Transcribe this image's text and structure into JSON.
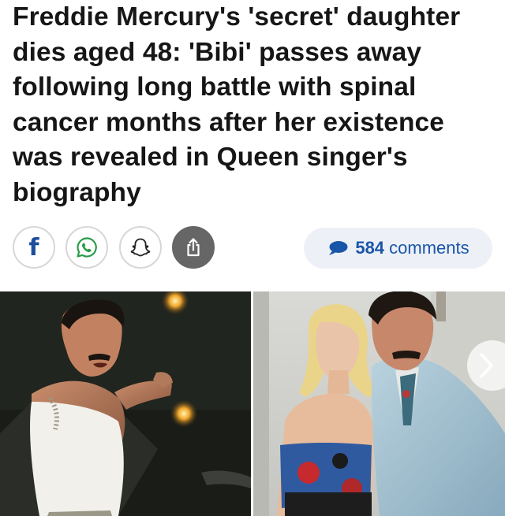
{
  "article": {
    "headline": "Freddie Mercury's 'secret' daughter dies aged 48: 'Bibi' passes away following long battle with spinal cancer months after her existence was revealed in Queen singer's biography"
  },
  "share": {
    "icons": [
      "facebook-icon",
      "whatsapp-icon",
      "snapchat-icon",
      "share-icon"
    ]
  },
  "comments": {
    "count": "584",
    "label": "comments",
    "color": "#1a56a8"
  },
  "gallery": {
    "next_icon": "chevron-right-icon"
  },
  "colors": {
    "headline": "#161616",
    "pill_bg": "#edf1f7",
    "share_dark": "#666666",
    "facebook": "#1d4f9e"
  }
}
